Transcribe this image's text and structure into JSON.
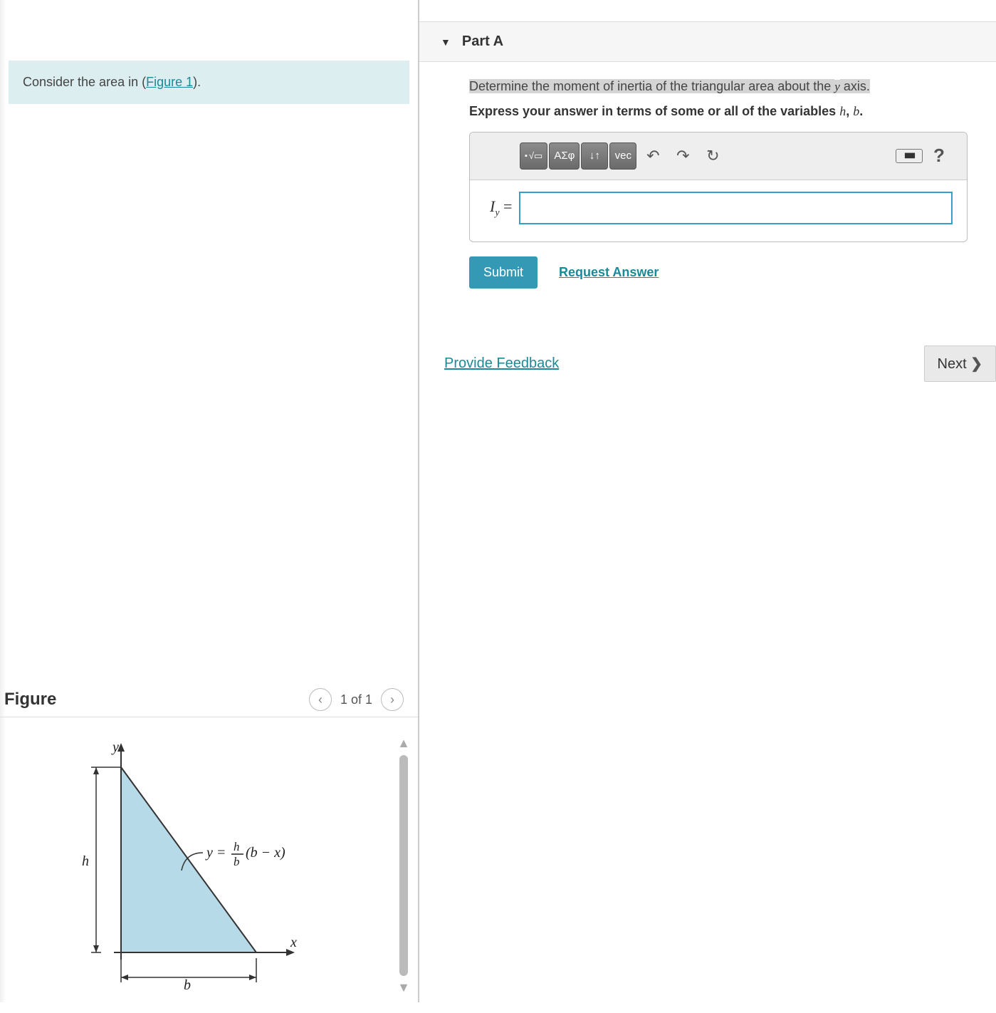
{
  "intro": {
    "prefix": "Consider the area in (",
    "link_text": "Figure 1",
    "suffix": ")."
  },
  "figure": {
    "title": "Figure",
    "nav_label": "1 of 1",
    "labels": {
      "y_axis": "y",
      "x_axis": "x",
      "height": "h",
      "base": "b",
      "equation_prefix": "y = ",
      "equation_frac_top": "h",
      "equation_frac_bot": "b",
      "equation_suffix": " (b − x)"
    }
  },
  "part": {
    "label": "Part A",
    "question_hl_1": "Determine the moment of inertia of the triangular area about the ",
    "question_hl_var": "y",
    "question_hl_2": " axis.",
    "instruction_prefix": "Express your answer in terms of some or all of the variables ",
    "instruction_var1": "h",
    "instruction_sep": ", ",
    "instruction_var2": "b",
    "instruction_suffix": "."
  },
  "toolbar": {
    "template": "▭",
    "sqrt": "√▭",
    "greek": "ΑΣφ",
    "arrows": "↓↑",
    "vec": "vec",
    "undo": "↶",
    "redo": "↷",
    "reset": "↻",
    "keyboard": "⌨",
    "help": "?"
  },
  "answer": {
    "label_main": "I",
    "label_sub": "y",
    "equals": " =",
    "value": ""
  },
  "actions": {
    "submit": "Submit",
    "request": "Request Answer"
  },
  "footer": {
    "feedback": "Provide Feedback",
    "next": "Next ",
    "next_icon": "❯"
  }
}
